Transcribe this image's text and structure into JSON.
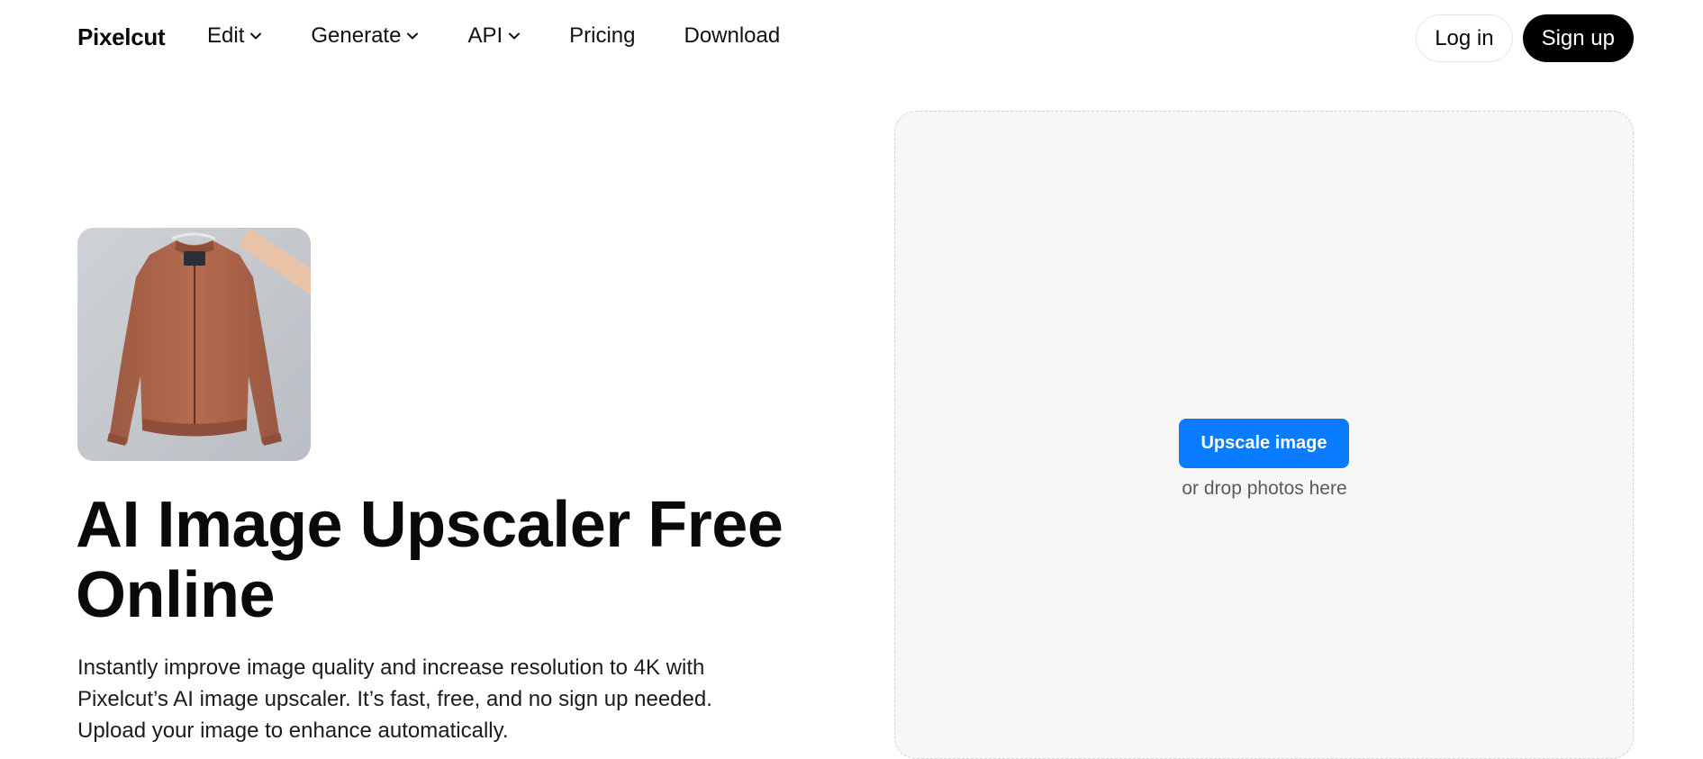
{
  "header": {
    "logo": "Pixelcut",
    "nav": [
      {
        "label": "Edit",
        "dropdown": true
      },
      {
        "label": "Generate",
        "dropdown": true
      },
      {
        "label": "API",
        "dropdown": true
      },
      {
        "label": "Pricing",
        "dropdown": false
      },
      {
        "label": "Download",
        "dropdown": false
      }
    ],
    "login_label": "Log in",
    "signup_label": "Sign up"
  },
  "hero": {
    "title": "AI Image Upscaler Free Online",
    "description": "Instantly improve image quality and increase resolution to 4K with Pixelcut’s AI image upscaler. It’s fast, free, and no sign up needed. Upload your image to enhance automatically."
  },
  "dropzone": {
    "button_label": "Upscale image",
    "hint": "or drop photos here"
  },
  "colors": {
    "accent": "#0a7cff",
    "dark": "#000000",
    "dropzone_bg": "#f7f7f7"
  }
}
